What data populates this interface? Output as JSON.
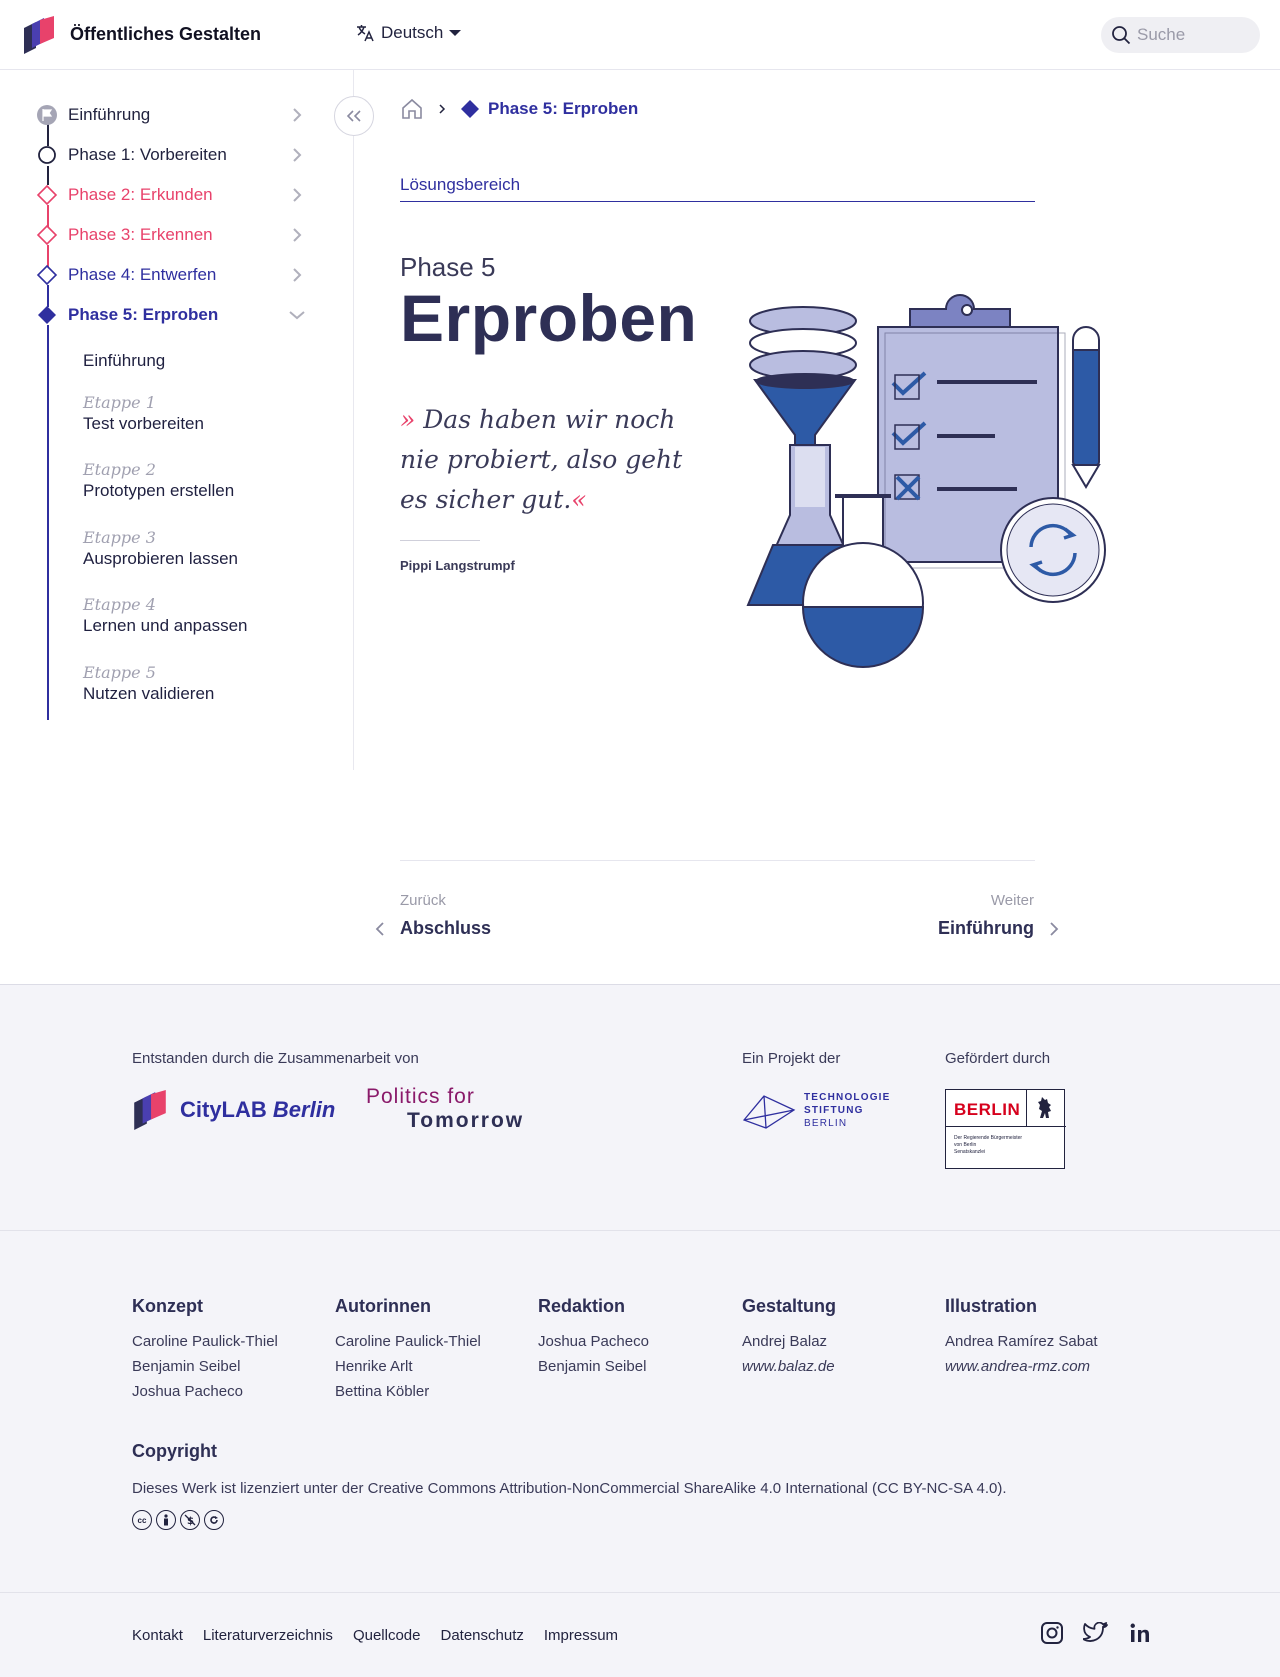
{
  "header": {
    "site_title": "Öffentliches Gestalten",
    "language": "Deutsch",
    "search_placeholder": "Suche"
  },
  "sidebar": {
    "items": [
      {
        "label": "Einführung",
        "color": "#22233f"
      },
      {
        "label": "Phase 1: Vorbereiten",
        "color": "#22233f"
      },
      {
        "label": "Phase 2: Erkunden",
        "color": "#e8426b"
      },
      {
        "label": "Phase 3: Erkennen",
        "color": "#e8426b"
      },
      {
        "label": "Phase 4: Entwerfen",
        "color": "#2f2f9f"
      },
      {
        "label": "Phase 5: Erproben",
        "color": "#2f2f9f"
      }
    ],
    "sub_intro": "Einführung",
    "subitems": [
      {
        "kicker": "Etappe 1",
        "label": "Test vorbereiten"
      },
      {
        "kicker": "Etappe 2",
        "label": "Prototypen erstellen"
      },
      {
        "kicker": "Etappe 3",
        "label": "Ausprobieren lassen"
      },
      {
        "kicker": "Etappe 4",
        "label": "Lernen und anpassen"
      },
      {
        "kicker": "Etappe 5",
        "label": "Nutzen validieren"
      }
    ]
  },
  "breadcrumb": {
    "current": "Phase 5: Erproben"
  },
  "main": {
    "section": "Lösungsbereich",
    "kicker": "Phase 5",
    "title": "Erproben",
    "quote_open": "»",
    "quote_text": " Das haben wir noch nie probiert, also geht es sicher gut.",
    "quote_close": "«",
    "quote_author": "Pippi Langstrumpf"
  },
  "pager": {
    "prev_small": "Zurück",
    "prev_label": "Abschluss",
    "next_small": "Weiter",
    "next_label": "Einführung"
  },
  "footer": {
    "collab_heading": "Entstanden durch die Zusammenarbeit von",
    "project_heading": "Ein Projekt der",
    "funded_heading": "Gefördert durch",
    "citylab": "CityLAB",
    "citylab_city": "Berlin",
    "pft_line1": "Politics for",
    "pft_line2": "Tomorrow",
    "tsb_lines": [
      "TECHNOLOGIE",
      "STIFTUNG",
      "BERLIN"
    ],
    "berlin_logo": "BERLIN",
    "berlin_sub": [
      "Der Regierende Bürgermeister",
      "von Berlin",
      "Senatskanzlei"
    ],
    "credits": [
      {
        "title": "Konzept",
        "lines": [
          "Caroline Paulick-Thiel",
          "Benjamin Seibel",
          "Joshua Pacheco"
        ]
      },
      {
        "title": "Autorinnen",
        "lines": [
          "Caroline Paulick-Thiel",
          "Henrike Arlt",
          "Bettina Köbler"
        ]
      },
      {
        "title": "Redaktion",
        "lines": [
          "Joshua Pacheco",
          "Benjamin Seibel"
        ]
      },
      {
        "title": "Gestaltung",
        "lines": [
          "Andrej Balaz"
        ],
        "web": "www.balaz.de"
      },
      {
        "title": "Illustration",
        "lines": [
          "Andrea Ramírez Sabat"
        ],
        "web": "www.andrea-rmz.com"
      }
    ],
    "copyright_title": "Copyright",
    "copyright_text": "Dieses Werk ist lizenziert unter der Creative Commons Attribution-NonCommercial ShareAlike 4.0 International (CC BY-NC-SA 4.0).",
    "links": [
      "Kontakt",
      "Literaturverzeichnis",
      "Quellcode",
      "Datenschutz",
      "Impressum"
    ]
  },
  "colors": {
    "primary": "#2f2f9f",
    "accent": "#e8426b",
    "text": "#22233f",
    "illustration_blue": "#2d5aa6",
    "illustration_light": "#b9bde0"
  }
}
